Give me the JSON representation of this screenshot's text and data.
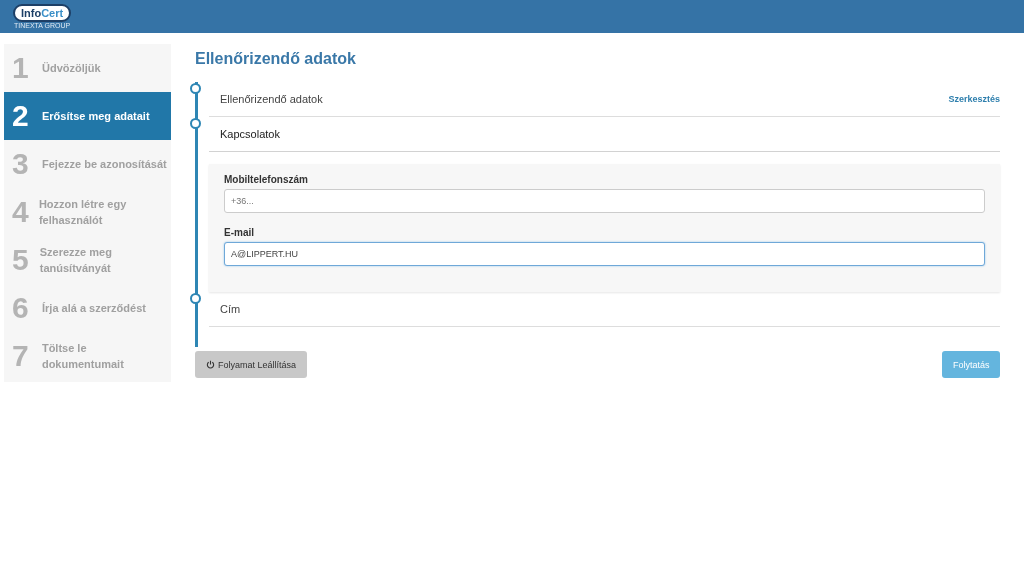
{
  "logo": {
    "brand_a": "Info",
    "brand_b": "Cert",
    "group": "TINEXTA GROUP"
  },
  "steps": [
    {
      "number": "1",
      "label": "Üdvözöljük",
      "selected": false
    },
    {
      "number": "2",
      "label": "Erősítse meg adatait",
      "selected": true
    },
    {
      "number": "3",
      "label": "Fejezze be azonosítását",
      "selected": false
    },
    {
      "number": "4",
      "label": "Hozzon létre egy felhasználót",
      "selected": false
    },
    {
      "number": "5",
      "label": "Szerezze meg tanúsítványát",
      "selected": false
    },
    {
      "number": "6",
      "label": "Írja alá a szerződést",
      "selected": false
    },
    {
      "number": "7",
      "label": "Töltse le dokumentumait",
      "selected": false
    }
  ],
  "page_title": "Ellenőrizendő adatok",
  "sections": [
    {
      "title": "Ellenőrizendő adatok",
      "action": "Szerkesztés",
      "expanded": false
    },
    {
      "title": "Kapcsolatok",
      "expanded": true,
      "fields": [
        {
          "label": "Mobiltelefonszám",
          "placeholder": "+36...",
          "focused": false
        },
        {
          "label": "E-mail",
          "value": "A@LIPPERT.HU",
          "focused": true
        }
      ]
    },
    {
      "title": "Cím",
      "expanded": false
    }
  ],
  "buttons": {
    "stop": "Folyamat Leállítása",
    "continue": "Folytatás"
  }
}
